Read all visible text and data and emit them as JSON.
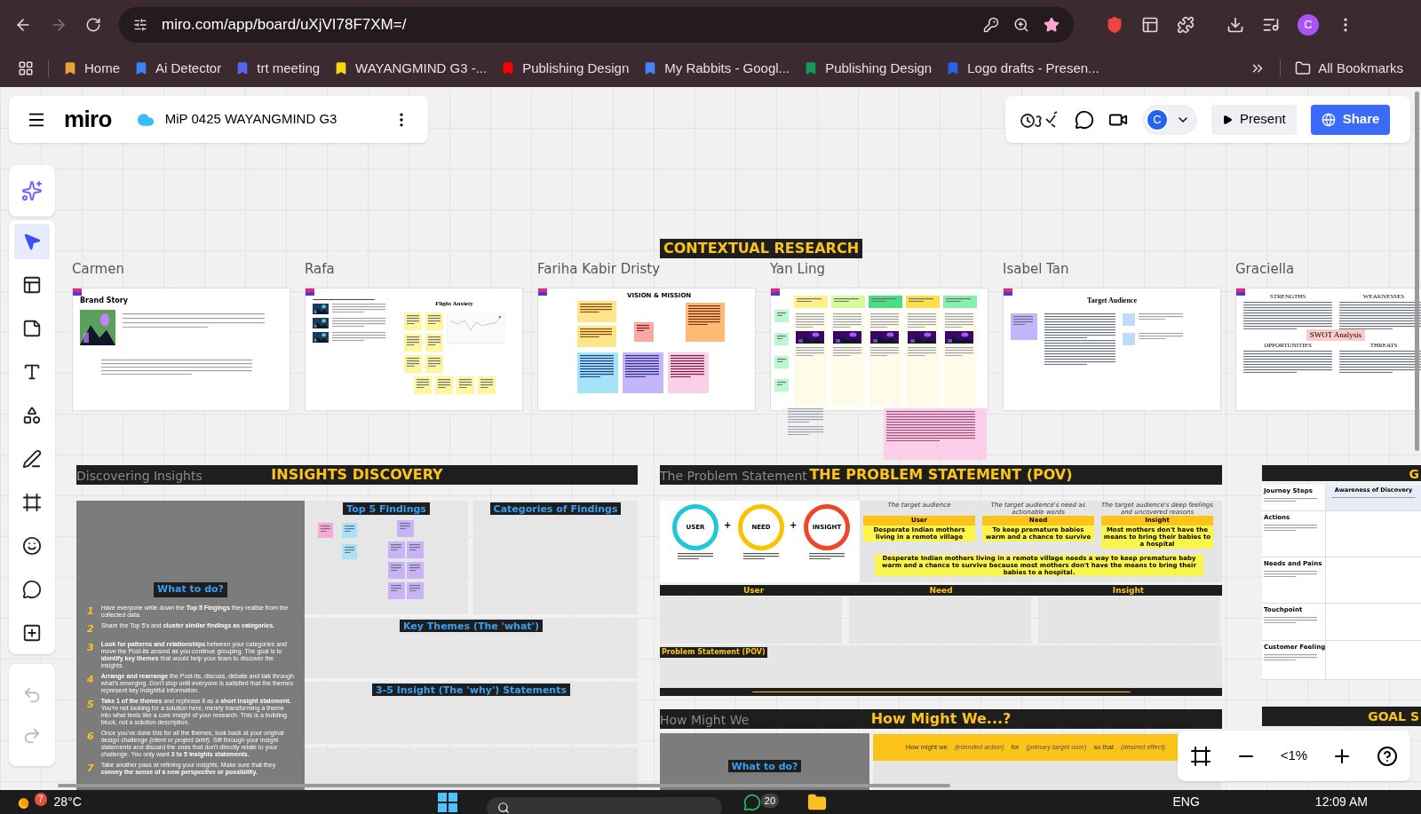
{
  "browser": {
    "url": "miro.com/app/board/uXjVI78F7XM=/",
    "profile": "C",
    "bookmarks": [
      {
        "label": "Home",
        "color": "#e8a23a"
      },
      {
        "label": "Ai Detector",
        "color": "#3b82f6"
      },
      {
        "label": "trt meeting",
        "color": "#5865f2"
      },
      {
        "label": "WAYANGMIND G3 -...",
        "color": "#f5d90a"
      },
      {
        "label": "Publishing Design",
        "color": "#ff0000"
      },
      {
        "label": "My Rabbits - Googl...",
        "color": "#4285f4"
      },
      {
        "label": "Publishing Design",
        "color": "#0f9d58"
      },
      {
        "label": "Logo drafts - Presen...",
        "color": "#2563eb"
      }
    ],
    "all_bookmarks": "All Bookmarks"
  },
  "board": {
    "logo": "miro",
    "title": "MiP 0425 WAYANGMIND G3",
    "avatar": "C",
    "present": "Present",
    "share": "Share"
  },
  "tools": [
    {
      "kind": "ai",
      "selected": false
    },
    {
      "kind": "select",
      "selected": true
    },
    {
      "kind": "templates",
      "selected": false
    },
    {
      "kind": "sticky",
      "selected": false
    },
    {
      "kind": "text",
      "selected": false
    },
    {
      "kind": "shapes",
      "selected": false
    },
    {
      "kind": "pen",
      "selected": false
    },
    {
      "kind": "frame",
      "selected": false
    },
    {
      "kind": "sticker",
      "selected": false
    },
    {
      "kind": "comment",
      "selected": false
    },
    {
      "kind": "more",
      "selected": false
    }
  ],
  "history": [
    {
      "kind": "undo",
      "disabled": true
    },
    {
      "kind": "redo",
      "disabled": true
    }
  ],
  "research": {
    "title": "CONTEXTUAL RESEARCH",
    "frames": [
      {
        "name": "Carmen",
        "kind": "brand",
        "heading": "Brand Story"
      },
      {
        "name": "Rafa",
        "kind": "product",
        "heading": "Flight Anxiety"
      },
      {
        "name": "Fariha Kabir Dristy",
        "kind": "vision",
        "heading": "VISION & MISSION"
      },
      {
        "name": "Yan Ling",
        "kind": "board"
      },
      {
        "name": "Isabel Tan",
        "kind": "audience",
        "heading": "Target Audience"
      },
      {
        "name": "Graciella",
        "kind": "swot",
        "heading": "SWOT Analysis",
        "texts": [
          "STRENGTHS",
          "WEAKNESSES",
          "OPPORTUNITIES",
          "THREATS"
        ]
      }
    ]
  },
  "insights": {
    "label": "Discovering Insights",
    "title": "INSIGHTS DISCOVERY",
    "guide_title": "What to do?",
    "steps": [
      {
        "number": "1",
        "text": "Have everyone write down the **Top 5 Fingings** they realise from the collected data."
      },
      {
        "number": "2",
        "text": "Share the Top 5's and **cluster similar findings as categories.**"
      },
      {
        "number": "3",
        "text": "**Look for patterns and relationships** between your categories and move the Post-its around as you continue grouping. The goal is to **identify key themes** that would help your team to discover the insights."
      },
      {
        "number": "4",
        "text": "**Arrange and rearrange** the Post-its, discuss, debate and talk through what's emerging. Don't stop until everyone is satisfied that the themes represent key insightful information."
      },
      {
        "number": "5",
        "text": "**Take 1 of the themes** and rephrase it as a **short insight statement.** You're not looking for a solution here, merely transforming a theme into what feels like a core insight of your research. This is a building block, not a solution description."
      },
      {
        "number": "6",
        "text": "Once you've done this for all the themes, look back at your original design challenge *(client or project brief)*. Sift through your insight statements and discard the ones that don't directly relate to your challenge. You only want **3 to 5 insights statements.**"
      },
      {
        "number": "7",
        "text": "Take another pass at refining your insights. Make sure that they **convey the sense of a new perspective or possibility.**"
      }
    ],
    "sections": [
      "Top 5 Findings",
      "Categories of Findings",
      "Key Themes (The 'what')",
      "3-5 Insight (The 'why') Statements"
    ]
  },
  "problem": {
    "label": "The Problem Statement",
    "title": "THE PROBLEM STATEMENT (POV)",
    "plus": [
      "+",
      "+"
    ],
    "circles": [
      {
        "label": "USER",
        "color": "#1ec8d8"
      },
      {
        "label": "NEED",
        "color": "#f8c400"
      },
      {
        "label": "INSIGHT",
        "color": "#ee4628"
      }
    ],
    "columns": [
      {
        "hint": "The target audience",
        "heading": "User",
        "value": "Desperate Indian mothers living in a remote village"
      },
      {
        "hint": "The target audience's need as actionable words",
        "heading": "Need",
        "value": "To keep premature babies warm and a chance to survive"
      },
      {
        "hint": "The target audience's deep feelings and uncovered reasons",
        "heading": "Insight",
        "value": "Most mothers don't have the means to bring their babies to a hospital"
      }
    ],
    "example": "Desperate Indian mothers living in a remote village needs a way to keep premature baby warm and a chance to survive because most mothers don't have the means to bring their babies to a hospital.",
    "bars": [
      "User",
      "Need",
      "Insight"
    ],
    "pov_label": "Problem Statement (POV)"
  },
  "hmw": {
    "label": "How Might We",
    "title": "How Might We...?",
    "guide_title": "What to do?",
    "template": [
      {
        "text": "How might we",
        "kind": "fixed"
      },
      {
        "text": "(intended action)",
        "kind": "slot"
      },
      {
        "text": "for",
        "kind": "fixed"
      },
      {
        "text": "(primary target user)",
        "kind": "slot"
      },
      {
        "text": "so that",
        "kind": "fixed"
      },
      {
        "text": "(desired effect)",
        "kind": "slot"
      }
    ]
  },
  "journey": {
    "header": "G",
    "stage": {
      "title": "Awareness of Discovery"
    },
    "rows": [
      {
        "title": "Journey Steps"
      },
      {
        "title": "Actions"
      },
      {
        "title": "Needs and Pains"
      },
      {
        "title": "Touchpoint"
      },
      {
        "title": "Customer Feeling"
      }
    ],
    "goal": "GOAL S"
  },
  "zoom": {
    "value": "<1%"
  },
  "taskbar": {
    "temperature": "28°C",
    "weather_badge": "7",
    "chat_badge": "20",
    "language": "ENG",
    "time": "12:09 AM"
  }
}
